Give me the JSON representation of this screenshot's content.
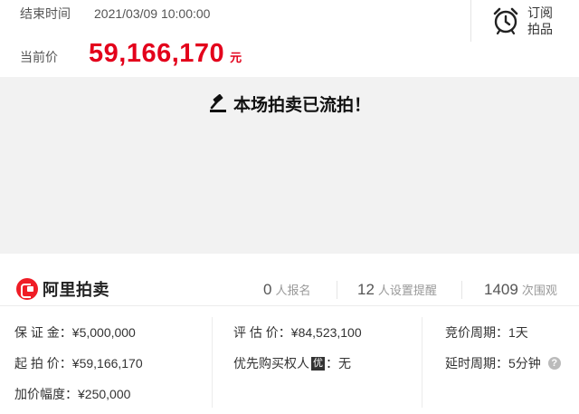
{
  "auction": {
    "end_time_label": "结束时间",
    "end_time_value": "2021/03/09 10:00:00",
    "current_price_label": "当前价",
    "current_price": "59,166,170",
    "currency_unit": "元",
    "subscribe_line1": "订阅",
    "subscribe_line2": "拍品",
    "status_message": "本场拍卖已流拍！"
  },
  "brand": {
    "name": "阿里拍卖"
  },
  "stats": [
    {
      "count": "0",
      "label": "人报名"
    },
    {
      "count": "12",
      "label": "人设置提醒"
    },
    {
      "count": "1409",
      "label": "次围观"
    }
  ],
  "details": {
    "deposit": "保 证 金：¥5,000,000",
    "starting_price": "起 拍 价：¥59,166,170",
    "increment": "加价幅度：¥250,000",
    "appraisal": "评 估 价：¥84,523,100",
    "preemptive_label": "优先购买权人",
    "preemptive_icon_char": "优",
    "preemptive_value": "：无",
    "bidding_period": "竞价周期：1天",
    "delay_period": "延时周期：5分钟",
    "help_char": "?"
  },
  "colors": {
    "price_red": "#e3001b",
    "brand_red": "#ef1d26",
    "banner_bg": "#f2f2f2"
  },
  "icons": {
    "subscribe": "alarm-clock-icon",
    "status": "gavel-icon",
    "brand": "ali-auction-logo-icon",
    "help": "question-icon"
  }
}
